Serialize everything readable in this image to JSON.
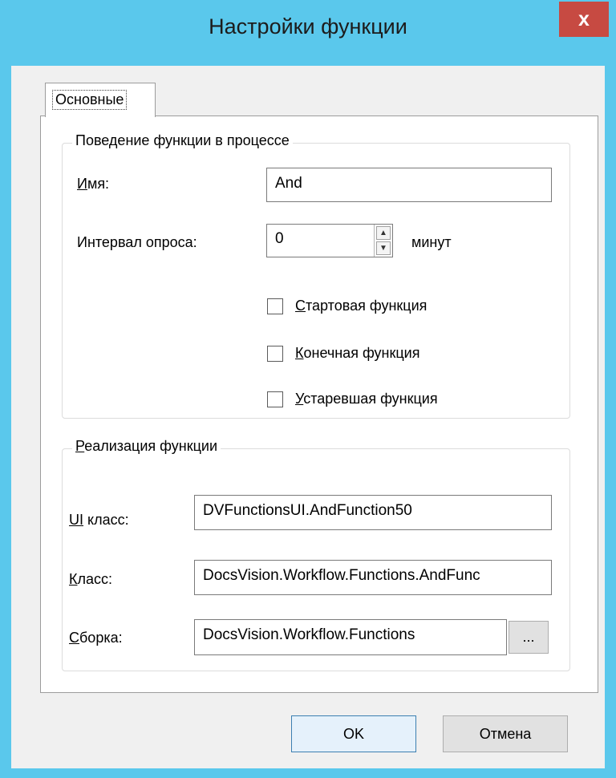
{
  "window": {
    "title": "Настройки функции",
    "close_label": "x"
  },
  "tabs": [
    {
      "label": "Основные"
    }
  ],
  "behavior": {
    "legend": "Поведение функции в процессе",
    "name_label_accel": "И",
    "name_label_rest": "мя:",
    "name_value": "And",
    "interval_label": "Интервал опроса:",
    "interval_value": "0",
    "interval_unit": "минут",
    "checkboxes": [
      {
        "accel": "С",
        "rest": "тартовая функция"
      },
      {
        "accel": "К",
        "rest": "онечная функция"
      },
      {
        "accel": "У",
        "rest": "старевшая функция"
      }
    ]
  },
  "implementation": {
    "legend_accel": "Р",
    "legend_rest": "еализация функции",
    "ui_class_label_accel": "UI",
    "ui_class_label_rest": " класс:",
    "ui_class_value": "DVFunctionsUI.AndFunction50",
    "class_label_accel": "К",
    "class_label_rest": "ласс:",
    "class_value": "DocsVision.Workflow.Functions.AndFunc",
    "assembly_label_accel": "С",
    "assembly_label_rest": "борка:",
    "assembly_value": "DocsVision.Workflow.Functions",
    "browse_label": "..."
  },
  "buttons": {
    "ok": "OK",
    "cancel": "Отмена"
  },
  "colors": {
    "titlebar": "#5ac8ec",
    "close": "#c74a42",
    "dialog_bg": "#f0f0f0"
  }
}
